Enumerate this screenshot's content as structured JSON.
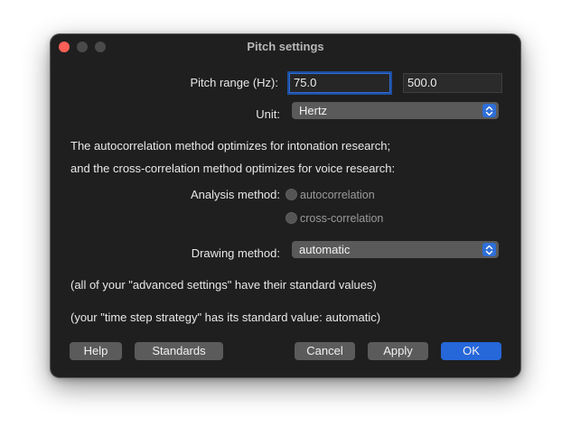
{
  "window": {
    "title": "Pitch settings"
  },
  "pitch_range": {
    "label": "Pitch range (Hz):",
    "min": "75.0",
    "max": "500.0"
  },
  "unit": {
    "label": "Unit:",
    "value": "Hertz"
  },
  "info": {
    "line1": "The autocorrelation method optimizes for intonation research;",
    "line2": "and the cross-correlation method optimizes for voice research:"
  },
  "analysis_method": {
    "label": "Analysis method:",
    "options": [
      "autocorrelation",
      "cross-correlation"
    ]
  },
  "drawing_method": {
    "label": "Drawing method:",
    "value": "automatic"
  },
  "notes": {
    "advanced": "(all of your \"advanced settings\" have their standard values)",
    "time_step": "(your \"time step strategy\" has its standard value: automatic)"
  },
  "buttons": {
    "help": "Help",
    "standards": "Standards",
    "cancel": "Cancel",
    "apply": "Apply",
    "ok": "OK"
  },
  "colors": {
    "close": "#fe5f57",
    "accent": "#2667d9",
    "window_bg": "#1f1f1f"
  }
}
